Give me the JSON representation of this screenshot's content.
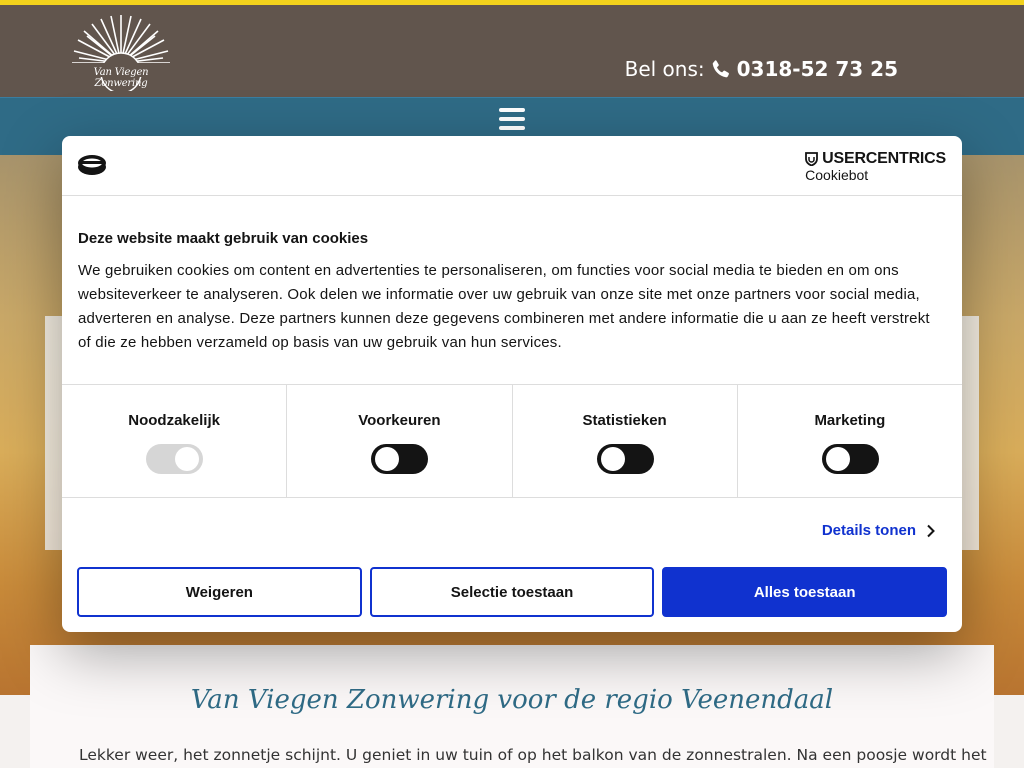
{
  "brand": {
    "logo_text": "Van Viegen Zonwering"
  },
  "header": {
    "phone_label": "Bel ons:",
    "phone_number": "0318-52 73 25"
  },
  "content": {
    "heading": "Van Viegen Zonwering voor de regio Veenendaal",
    "intro": "Lekker weer, het zonnetje schijnt. U geniet in uw tuin of op het balkon van de zonnestralen. Na een poosje wordt het"
  },
  "cookie": {
    "provider_name": "USERCENTRICS",
    "provider_product": "Cookiebot",
    "title": "Deze website maakt gebruik van cookies",
    "text": "We gebruiken cookies om content en advertenties te personaliseren, om functies voor social media te bieden en om ons websiteverkeer te analyseren. Ook delen we informatie over uw gebruik van onze site met onze partners voor social media, adverteren en analyse. Deze partners kunnen deze gegevens combineren met andere informatie die u aan ze heeft verstrekt of die ze hebben verzameld op basis van uw gebruik van hun services.",
    "categories": [
      {
        "label": "Noodzakelijk",
        "checked": true,
        "disabled": true
      },
      {
        "label": "Voorkeuren",
        "checked": false,
        "disabled": false
      },
      {
        "label": "Statistieken",
        "checked": false,
        "disabled": false
      },
      {
        "label": "Marketing",
        "checked": false,
        "disabled": false
      }
    ],
    "details_label": "Details tonen",
    "buttons": {
      "deny": "Weigeren",
      "selection": "Selectie toestaan",
      "allow_all": "Alles toestaan"
    }
  },
  "colors": {
    "header_bg": "#61554d",
    "navbar_bg": "#2f6b86",
    "accent_yellow": "#f2d21c",
    "cookie_blue": "#1032cf"
  },
  "icons": {
    "phone": "phone-icon",
    "menu": "hamburger-menu-icon",
    "consent_logo": "cookie-consent-icon",
    "details": "chevron-right-icon"
  }
}
